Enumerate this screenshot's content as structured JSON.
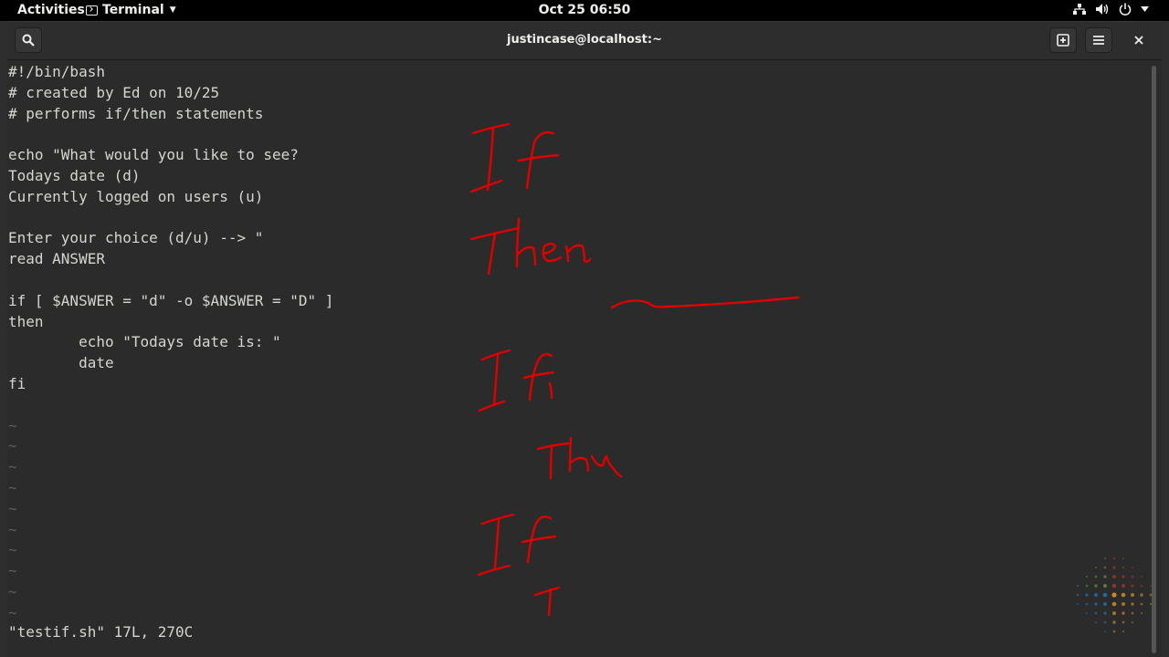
{
  "topbar": {
    "activities": "Activities",
    "app_menu": "Terminal",
    "clock": "Oct 25  06:50",
    "icons": [
      "network-icon",
      "volume-icon",
      "power-icon",
      "chevron-down-icon"
    ]
  },
  "window": {
    "title": "justincase@localhost:~"
  },
  "terminal": {
    "lines": [
      "#!/bin/bash",
      "# created by Ed on 10/25",
      "# performs if/then statements",
      "",
      "echo \"What would you like to see?",
      "Todays date (d)",
      "Currently logged on users (u)",
      "",
      "Enter your choice (d/u) --> \"",
      "read ANSWER",
      "",
      "if [ $ANSWER = \"d\" -o $ANSWER = \"D\" ]",
      "then",
      "        echo \"Todays date is: \"",
      "        date",
      "fi",
      "",
      "~",
      "~",
      "~",
      "~",
      "~",
      "~",
      "~",
      "~",
      "~",
      "~"
    ],
    "status": "\"testif.sh\" 17L, 270C"
  },
  "annotations": {
    "color": "#e00000",
    "words": [
      "If",
      "Then",
      "If",
      "Then",
      "If"
    ]
  },
  "colors": {
    "topbar": "#000000",
    "headerbar": "#2d2d2d",
    "terminal_bg": "#2b2b2b",
    "terminal_fg": "#d3d7cf"
  }
}
